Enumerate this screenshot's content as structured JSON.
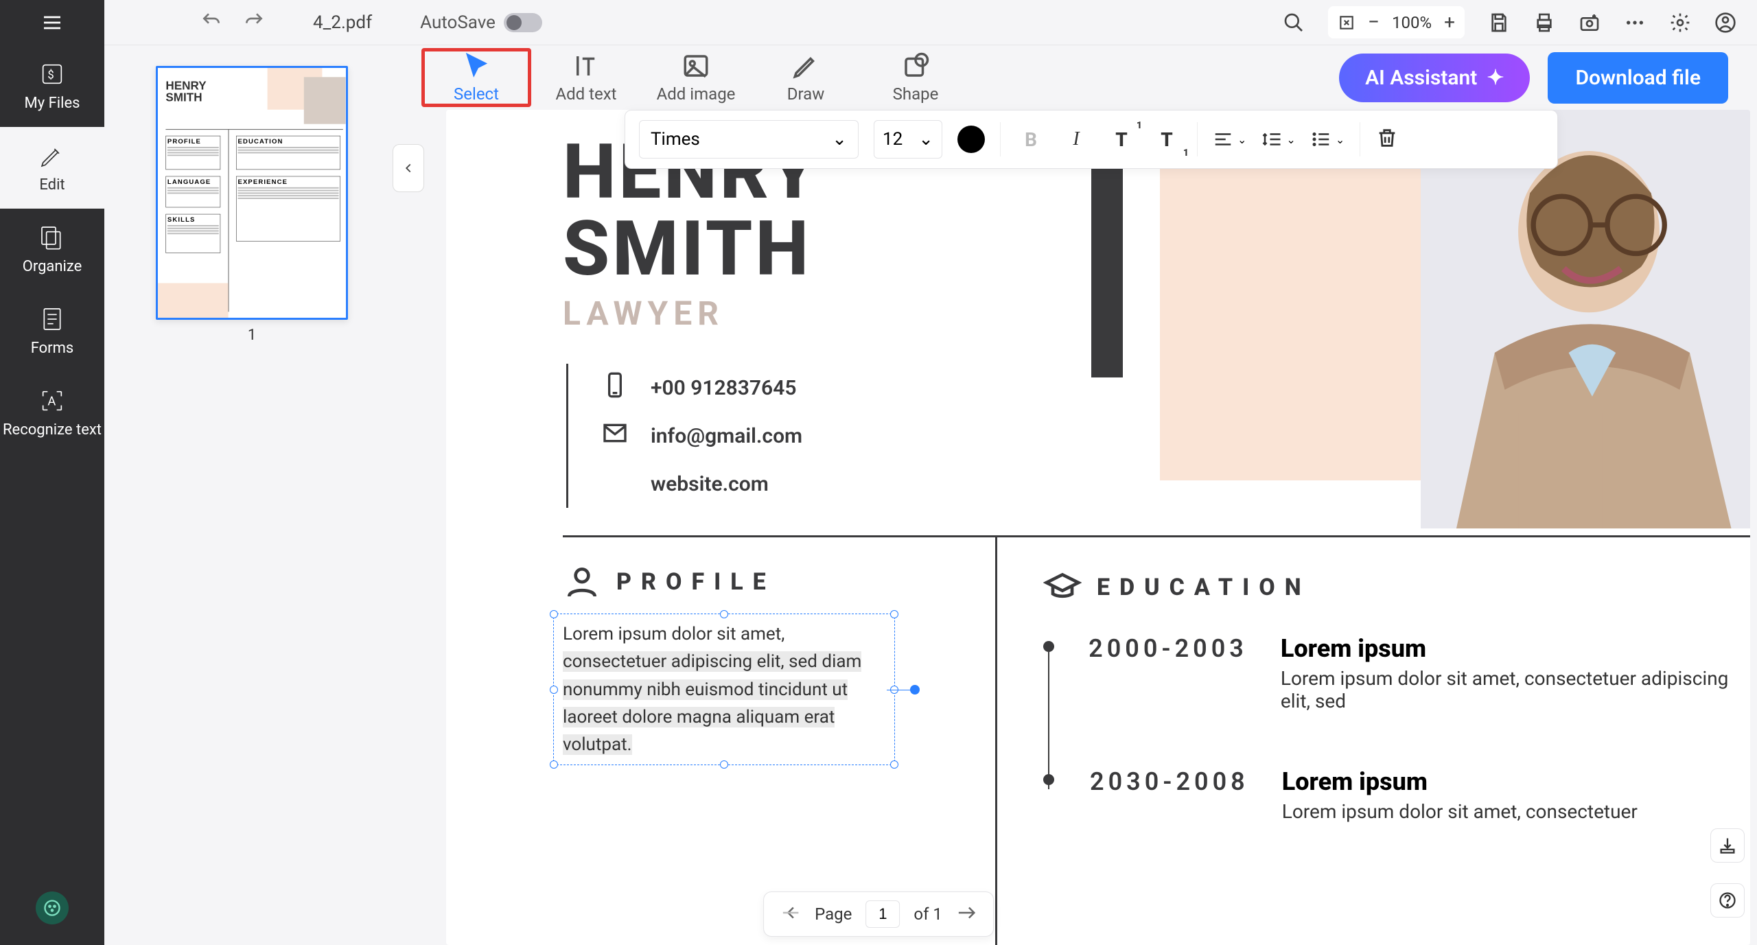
{
  "topbar": {
    "filename": "4_2.pdf",
    "autosave_label": "AutoSave",
    "zoom": "100%"
  },
  "sidebar": {
    "my_files": "My Files",
    "edit": "Edit",
    "organize": "Organize",
    "forms": "Forms",
    "recognize": "Recognize text"
  },
  "tools": {
    "select": "Select",
    "add_text": "Add text",
    "add_image": "Add image",
    "draw": "Draw",
    "shape": "Shape",
    "ai_assistant": "AI Assistant",
    "download": "Download file"
  },
  "format": {
    "font": "Times",
    "size": "12"
  },
  "thumbnail": {
    "page_number": "1"
  },
  "document": {
    "first_name": "HENRY",
    "last_name": "SMITH",
    "profession": "LAWYER",
    "phone": "+00 912837645",
    "email": "info@gmail.com",
    "website": "website.com",
    "profile_heading": "PROFILE",
    "profile_text_plain": "Lorem ipsum dolor sit amet, ",
    "profile_text_hl": "consectetuer adipiscing elit, sed diam nonummy nibh euismod tincidunt ut laoreet dolore magna aliquam erat volutpat.",
    "education_heading": "EDUCATION",
    "education": [
      {
        "years": "2000-2003",
        "title": "Lorem ipsum",
        "desc": "Lorem ipsum dolor sit amet, consectetuer adipiscing elit, sed"
      },
      {
        "years": "2030-2008",
        "title": "Lorem ipsum",
        "desc": "Lorem ipsum dolor sit amet, consectetuer"
      }
    ]
  },
  "page_nav": {
    "label": "Page",
    "current": "1",
    "of_total": "of 1"
  }
}
